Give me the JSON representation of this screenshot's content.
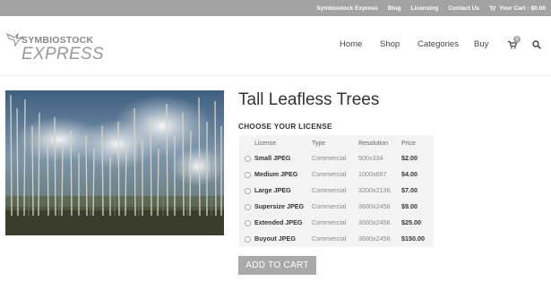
{
  "topbar": {
    "links": [
      "Symbiostock Express",
      "Blog",
      "Licensing",
      "Contact Us"
    ],
    "cart": "Your Cart - $0.00"
  },
  "logo": {
    "line1": "SYMBIOSTOCK",
    "line2": "EXPRESS"
  },
  "nav": {
    "items": [
      "Home",
      "Shop",
      "Categories",
      "Buy"
    ],
    "cart_count": "0",
    "icons": {
      "cart": "shopping-cart-icon",
      "search": "search-icon"
    }
  },
  "product": {
    "title": "Tall Leafless Trees",
    "image_alt_icon": "forest-photo"
  },
  "license": {
    "heading": "CHOOSE YOUR LICENSE",
    "columns": [
      "License",
      "Type",
      "Resolution",
      "Price"
    ],
    "rows": [
      {
        "name": "Small JPEG",
        "type": "Commercial",
        "resolution": "500x334",
        "price": "$2.00"
      },
      {
        "name": "Medium JPEG",
        "type": "Commercial",
        "resolution": "1000x667",
        "price": "$4.00"
      },
      {
        "name": "Large JPEG",
        "type": "Commercial",
        "resolution": "3200x2136",
        "price": "$7.00"
      },
      {
        "name": "Supersize JPEG",
        "type": "Commercial",
        "resolution": "3680x2456",
        "price": "$9.00"
      },
      {
        "name": "Extended JPEG",
        "type": "Commercial",
        "resolution": "3680x2456",
        "price": "$25.00"
      },
      {
        "name": "Buyout JPEG",
        "type": "Commercial",
        "resolution": "3680x2456",
        "price": "$150.00"
      }
    ]
  },
  "actions": {
    "add_to_cart": "ADD TO CART"
  },
  "colors": {
    "topbar": "#a3a3a3",
    "button": "#a9a9a9",
    "license_bg": "#f3f3f3"
  }
}
